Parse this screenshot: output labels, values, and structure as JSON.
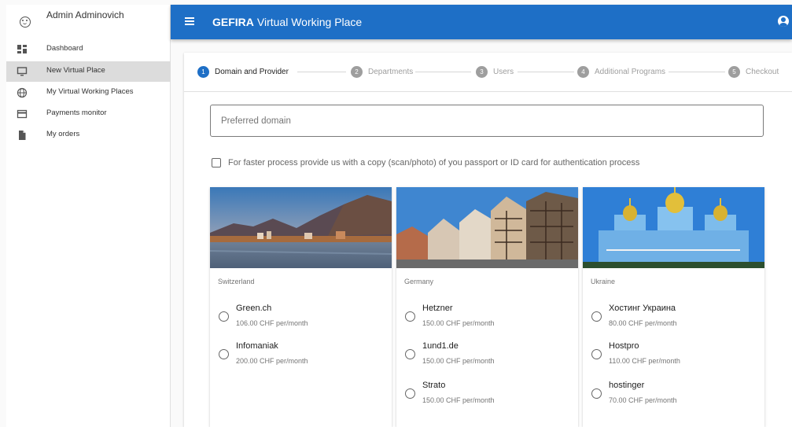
{
  "sidebar": {
    "user_name": "Admin Adminovich",
    "items": [
      {
        "label": "Dashboard",
        "icon": "dashboard-icon"
      },
      {
        "label": "New Virtual Place",
        "icon": "monitor-icon",
        "active": true
      },
      {
        "label": "My Virtual Working Places",
        "icon": "globe-icon"
      },
      {
        "label": "Payments monitor",
        "icon": "credit-card-icon"
      },
      {
        "label": "My orders",
        "icon": "document-icon"
      }
    ]
  },
  "header": {
    "brand": "GEFIRA",
    "title": "Virtual Working Place",
    "color": "#1e6fc6"
  },
  "stepper": {
    "steps": [
      {
        "number": "1",
        "label": "Domain and Provider",
        "active": true
      },
      {
        "number": "2",
        "label": "Departments"
      },
      {
        "number": "3",
        "label": "Users"
      },
      {
        "number": "4",
        "label": "Additional Programs"
      },
      {
        "number": "5",
        "label": "Checkout"
      }
    ]
  },
  "form": {
    "domain_placeholder": "Preferred domain",
    "checkbox_label": "For faster process provide us with a copy (scan/photo) of you passport or ID card for authentication process"
  },
  "providers": [
    {
      "country": "Switzerland",
      "options": [
        {
          "name": "Green.ch",
          "price": "106.00 CHF per/month"
        },
        {
          "name": "Infomaniak",
          "price": "200.00 CHF per/month"
        }
      ]
    },
    {
      "country": "Germany",
      "options": [
        {
          "name": "Hetzner",
          "price": "150.00 CHF per/month"
        },
        {
          "name": "1und1.de",
          "price": "150.00 CHF per/month"
        },
        {
          "name": "Strato",
          "price": "150.00 CHF per/month"
        }
      ]
    },
    {
      "country": "Ukraine",
      "options": [
        {
          "name": "Хостинг Украина",
          "price": "80.00 CHF per/month"
        },
        {
          "name": "Hostpro",
          "price": "110.00 CHF per/month"
        },
        {
          "name": "hostinger",
          "price": "70.00 CHF per/month"
        }
      ]
    }
  ]
}
